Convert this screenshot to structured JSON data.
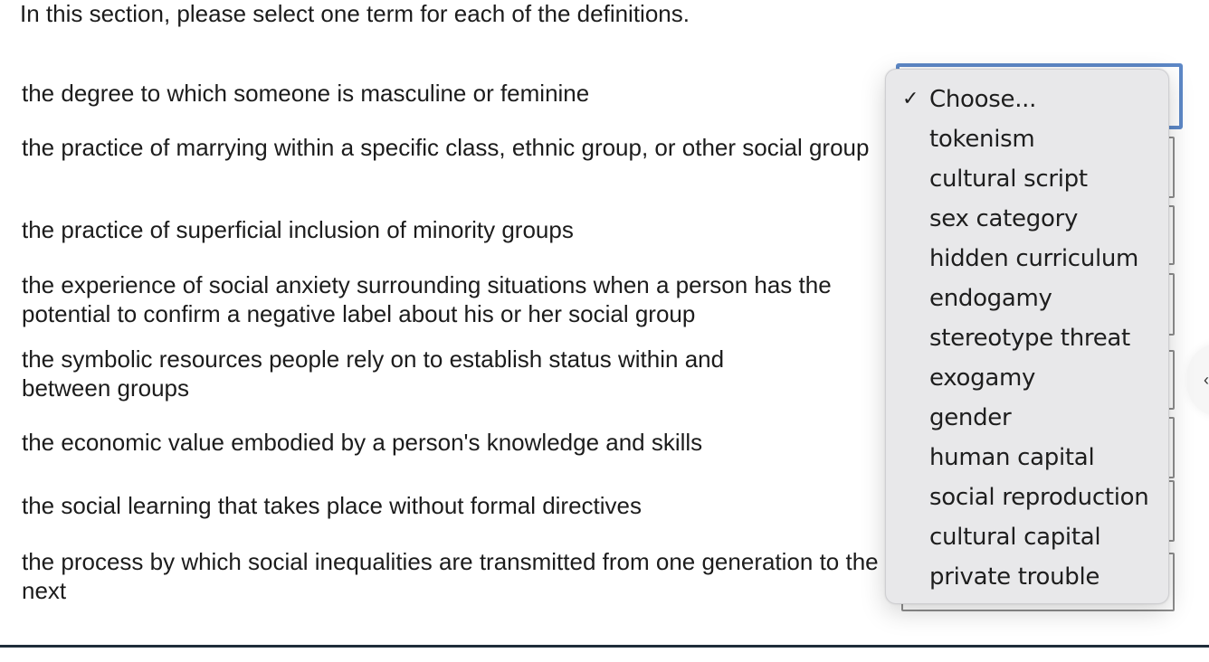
{
  "instructions": "In this section, please select one term for each of the definitions.",
  "definitions": [
    {
      "text": "the degree to which someone is masculine or feminine",
      "selected": "Choose..."
    },
    {
      "text": "the practice of marrying within a specific class, ethnic group, or other social group",
      "selected": ""
    },
    {
      "text": "the practice of superficial inclusion of minority groups",
      "selected": ""
    },
    {
      "text": "the experience of social anxiety surrounding situations when a person has the potential to confirm a negative label about his or her social group",
      "selected": ""
    },
    {
      "text": "the symbolic resources people rely on to establish status within and between groups",
      "selected": ""
    },
    {
      "text": "the economic value embodied by a person's knowledge and skills",
      "selected": ""
    },
    {
      "text": "the social learning that takes place without formal directives",
      "selected": ""
    },
    {
      "text": "the process by which social inequalities are transmitted from one generation to the next",
      "selected": ""
    }
  ],
  "dropdown": {
    "open_for_definition": 0,
    "checked_option": "Choose...",
    "check_icon": "✓",
    "options": [
      "Choose...",
      "tokenism",
      "cultural script",
      "sex category",
      "hidden curriculum",
      "endogamy",
      "stereotype threat",
      "exogamy",
      "gender",
      "human capital",
      "social reproduction",
      "cultural capital",
      "private trouble"
    ]
  },
  "side_nav": {
    "icon": "chevron-left-icon",
    "glyph": "‹"
  },
  "colors": {
    "focus_border": "#5d88c7",
    "popup_background": "#e8e8ea",
    "rule": "#1f2d3a"
  }
}
